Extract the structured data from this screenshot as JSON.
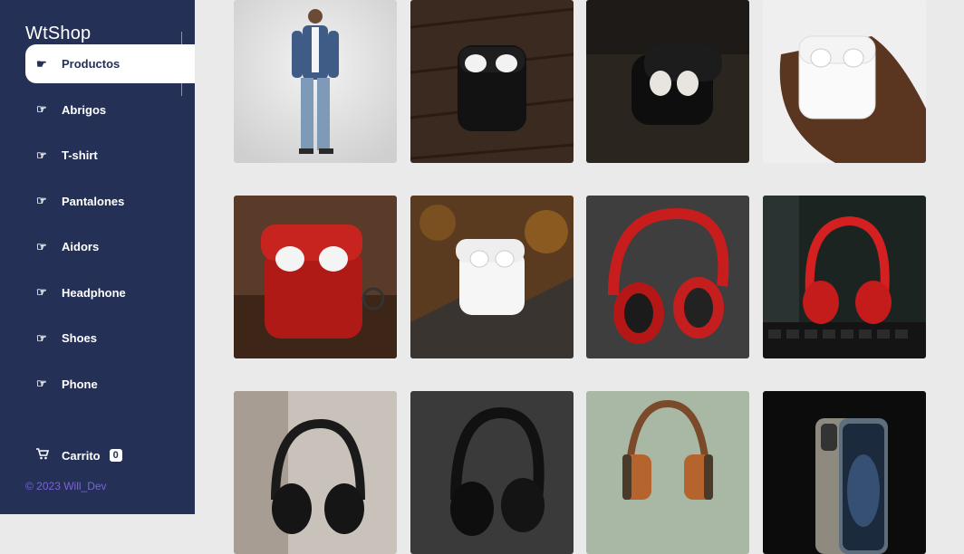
{
  "brand": "WtShop",
  "nav": [
    {
      "label": "Productos",
      "icon": "hand-pointing-icon"
    },
    {
      "label": "Abrigos",
      "icon": "hand-pointing-icon"
    },
    {
      "label": "T-shirt",
      "icon": "hand-pointing-icon"
    },
    {
      "label": "Pantalones",
      "icon": "hand-pointing-icon"
    },
    {
      "label": "Aidors",
      "icon": "hand-pointing-icon"
    },
    {
      "label": "Headphone",
      "icon": "hand-pointing-icon"
    },
    {
      "label": "Shoes",
      "icon": "hand-pointing-icon"
    },
    {
      "label": "Phone",
      "icon": "hand-pointing-icon"
    }
  ],
  "cart": {
    "label": "Carrito",
    "count": "0",
    "icon": "cart-icon"
  },
  "footer": "© 2023 Will_Dev",
  "products": [
    {
      "name": "man-jeans-image"
    },
    {
      "name": "black-airpods-image"
    },
    {
      "name": "black-airpods-open-image"
    },
    {
      "name": "airpods-in-hand-image"
    },
    {
      "name": "red-airpods-case-image"
    },
    {
      "name": "white-airpods-rock-image"
    },
    {
      "name": "red-headphones-image"
    },
    {
      "name": "red-headphones-studio-image"
    },
    {
      "name": "black-headphones-image"
    },
    {
      "name": "black-headphones-dark-image"
    },
    {
      "name": "brown-headphones-image"
    },
    {
      "name": "iphone-image"
    }
  ],
  "colors": {
    "sidebar": "#243056",
    "background": "#eaeaea",
    "footer": "#7b63d8"
  }
}
